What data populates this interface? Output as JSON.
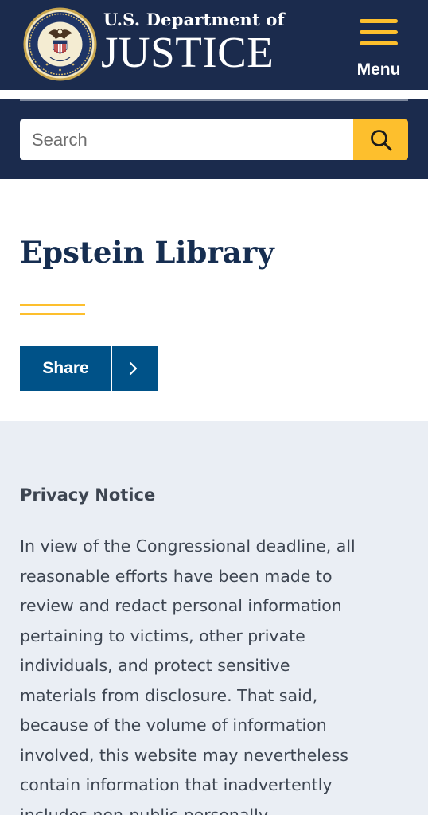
{
  "header": {
    "seal_icon": "doj-seal-icon",
    "brand_subtitle": "U.S. Department of",
    "brand_title": "JUSTICE",
    "menu_icon": "hamburger-menu-icon",
    "menu_label": "Menu",
    "colors": {
      "background": "#1b2b4d",
      "accent": "#fdbf2d"
    }
  },
  "search": {
    "placeholder": "Search",
    "value": "",
    "button_icon": "search-icon"
  },
  "page": {
    "title": "Epstein Library",
    "share_label": "Share",
    "share_icon": "chevron-right-icon"
  },
  "notice": {
    "title": "Privacy Notice",
    "body": "In view of the Congressional deadline, all\nreasonable efforts have been made to\nreview and redact personal information\npertaining to victims, other private\nindividuals, and protect sensitive\nmaterials from disclosure.  That said,\nbecause of the volume of information\ninvolved, this website may nevertheless\ncontain information that inadvertently\nincludes non-public personally"
  }
}
